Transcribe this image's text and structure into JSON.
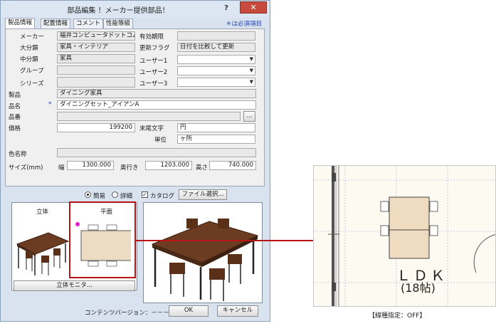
{
  "window": {
    "title": "部品編集 ！メーカー提供部品！",
    "help": "?",
    "close": "✕"
  },
  "tabs": [
    {
      "label": "製品情報"
    },
    {
      "label": "配置情報"
    },
    {
      "label": "コメント"
    },
    {
      "label": "性能等級"
    }
  ],
  "required_note": "＊は必須項目",
  "form": {
    "maker_label": "メーカー",
    "maker": "福井コンピュータドットコム",
    "large_label": "大分類",
    "large": "家具・インテリア",
    "mid_label": "中分類",
    "mid": "家具",
    "group_label": "グループ",
    "series_label": "シリーズ",
    "expiry_label": "有効期限",
    "update_flag_label": "更新フラグ",
    "update_flag": "日付を比較して更新",
    "user1_label": "ユーザー1",
    "user2_label": "ユーザー2",
    "user3_label": "ユーザー3",
    "product_label": "製品",
    "product": "ダイニング家具",
    "name_label": "品名",
    "name": "ダイニングセット_アイアンA",
    "number_label": "品番",
    "browse": "...",
    "price_label": "価格",
    "price": "199200",
    "suffix_label": "末尾文字",
    "suffix": "円",
    "unit_label": "単位",
    "unit": "ヶ所",
    "color_label": "色名称",
    "size_label": "サイズ(mm)",
    "width_label": "幅",
    "width": "1300.000",
    "depth_label": "奥行き",
    "depth": "1203.000",
    "height_label": "高さ",
    "height": "740.000"
  },
  "view": {
    "simple": "簡易",
    "detail": "詳細",
    "catalog": "カタログ",
    "file_select": "ファイル選択...",
    "solid": "立体",
    "plan": "平面",
    "monitor": "立体モニタ..."
  },
  "footer": {
    "content_version": "コンテンツバージョン：－－－",
    "ok": "OK",
    "cancel": "キャンセル"
  },
  "plan": {
    "room_name": "ＬＤＫ",
    "room_size": "(18帖)",
    "caption": "【線種指定：OFF】"
  }
}
